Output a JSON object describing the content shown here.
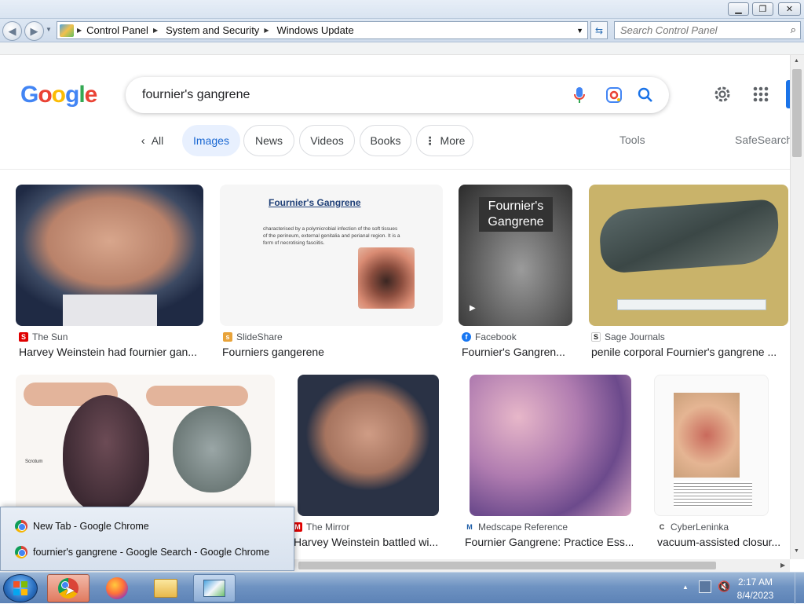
{
  "control_panel": {
    "breadcrumb": [
      "Control Panel",
      "System and Security",
      "Windows Update"
    ],
    "search_placeholder": "Search Control Panel"
  },
  "google": {
    "query": "fournier's gangrene",
    "tabs": [
      {
        "label": "All",
        "selected": false
      },
      {
        "label": "Images",
        "selected": true
      },
      {
        "label": "News",
        "selected": false
      },
      {
        "label": "Videos",
        "selected": false
      },
      {
        "label": "Books",
        "selected": false
      },
      {
        "label": "More",
        "selected": false
      }
    ],
    "tools_label": "Tools",
    "safesearch_label": "SafeSearch",
    "results": [
      {
        "source": "The Sun",
        "caption": "Harvey Weinstein had fournier gan...",
        "favicon_color": "#e00000",
        "favicon": "S"
      },
      {
        "source": "SlideShare",
        "caption": "Fourniers gangerene",
        "favicon_color": "#e8a33a",
        "favicon": "s"
      },
      {
        "source": "Facebook",
        "caption": "Fournier's Gangren...",
        "favicon_color": "#1877f2",
        "favicon": "f"
      },
      {
        "source": "Sage Journals",
        "caption": "penile corporal Fournier's gangrene ...",
        "favicon_color": "#ffffff",
        "favicon": "S"
      },
      {
        "source": "The Mirror",
        "caption": "Harvey Weinstein battled wi...",
        "favicon_color": "#e00000",
        "favicon": "M"
      },
      {
        "source": "Medscape Reference",
        "caption": "Fournier Gangrene: Practice Ess...",
        "favicon_color": "#ffffff",
        "favicon": "M"
      },
      {
        "source": "CyberLeninka",
        "caption": "vacuum-assisted closur...",
        "favicon_color": "#ffffff",
        "favicon": "C"
      }
    ],
    "thumb_texts": {
      "slide_title": "Fournier's Gangrene",
      "slide_body": "characterised by a polymicrobial infection of the soft tissues of the perineum, external genitalia and perianal region. It is a form of necrotising fasciitis.",
      "fb_overlay": "Fournier's Gangrene",
      "scrotum_label": "Scrotum"
    }
  },
  "jumplist": {
    "items": [
      "New Tab - Google Chrome",
      "fournier's gangrene - Google Search - Google Chrome"
    ]
  },
  "taskbar": {
    "time": "2:17 AM",
    "date": "8/4/2023"
  },
  "colors": {
    "google_blue": "#1a73e8",
    "chip_selected_bg": "#e8f0fe",
    "taskbar": "#6f93c2"
  }
}
